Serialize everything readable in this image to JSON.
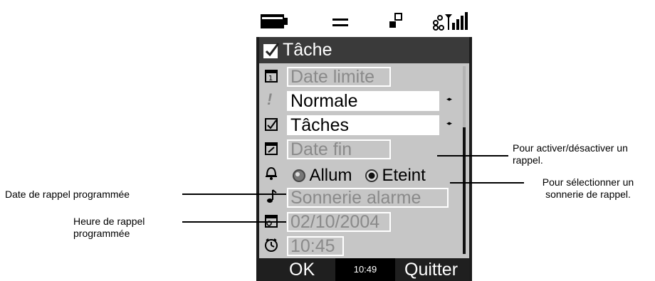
{
  "screen": {
    "title": "Tâche",
    "fields": {
      "due_date_placeholder": "Date limite",
      "priority_value": "Normale",
      "category_value": "Tâches",
      "end_date_placeholder": "Date fin",
      "alarm_on_label": "Allum",
      "alarm_off_label": "Eteint",
      "alarm_selected": "Eteint",
      "ringtone_value": "Sonnerie alarme",
      "reminder_date_value": "02/10/2004",
      "reminder_time_value": "10:45"
    },
    "softkeys": {
      "left": "OK",
      "clock": "10:49",
      "right": "Quitter"
    },
    "status_icons": [
      "battery-icon",
      "equals-icon",
      "network-icon",
      "signal-strength-icon"
    ]
  },
  "callouts": {
    "toggle_alarm": "Pour  activer/désactiver un rappel.",
    "select_ringtone": "Pour sélectionner un sonnerie de rappel.",
    "reminder_date": "Date de rappel programmée",
    "reminder_time": "Heure de rappel programmée"
  },
  "colors": {
    "content_bg": "#c6c6c6",
    "title_bg": "#3a3a3a",
    "softkey_bg": "#1f1f1f"
  }
}
